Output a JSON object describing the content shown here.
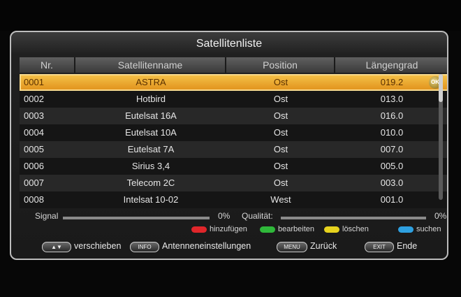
{
  "title": "Satellitenliste",
  "columns": [
    "Nr.",
    "Satellitenname",
    "Position",
    "Längengrad"
  ],
  "rows": [
    {
      "nr": "0001",
      "name": "ASTRA",
      "position": "Ost",
      "longitude": "019.2",
      "selected": true
    },
    {
      "nr": "0002",
      "name": "Hotbird",
      "position": "Ost",
      "longitude": "013.0"
    },
    {
      "nr": "0003",
      "name": "Eutelsat 16A",
      "position": "Ost",
      "longitude": "016.0"
    },
    {
      "nr": "0004",
      "name": "Eutelsat 10A",
      "position": "Ost",
      "longitude": "010.0"
    },
    {
      "nr": "0005",
      "name": "Eutelsat 7A",
      "position": "Ost",
      "longitude": "007.0"
    },
    {
      "nr": "0006",
      "name": "Sirius 3,4",
      "position": "Ost",
      "longitude": "005.0"
    },
    {
      "nr": "0007",
      "name": "Telecom 2C",
      "position": "Ost",
      "longitude": "003.0"
    },
    {
      "nr": "0008",
      "name": "Intelsat 10-02",
      "position": "West",
      "longitude": "001.0"
    }
  ],
  "ok_badge": "OK",
  "signal": {
    "label": "Signal",
    "percent": "0%",
    "level": 0
  },
  "quality": {
    "label": "Qualität:",
    "percent": "0%",
    "level": 0
  },
  "color_keys": [
    {
      "label": "hinzufügen",
      "color": "#e0262a"
    },
    {
      "label": "bearbeiten",
      "color": "#2fb83a"
    },
    {
      "label": "löschen",
      "color": "#e6d21e"
    },
    {
      "label": "suchen",
      "color": "#2ea0e0"
    }
  ],
  "nav": {
    "move_key": "▲▼",
    "move_label": "verschieben",
    "info_key": "INFO",
    "info_label": "Antenneneinstellungen",
    "menu_key": "MENU",
    "menu_label": "Zurück",
    "exit_key": "EXIT",
    "exit_label": "Ende"
  }
}
